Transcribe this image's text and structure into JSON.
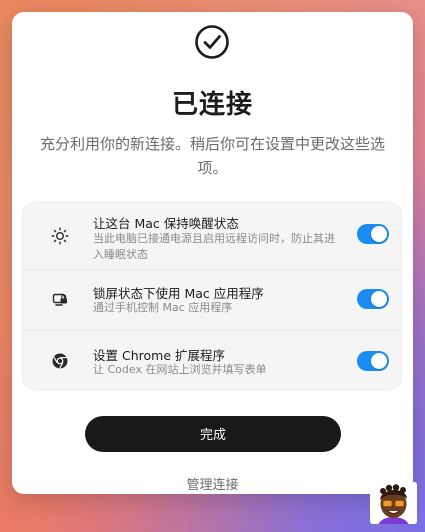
{
  "dialog": {
    "title": "已连接",
    "subtitle": "充分利用你的新连接。稍后你可在设置中更改这些选项。",
    "options": [
      {
        "icon": "sun-icon",
        "title": "让这台 Mac 保持唤醒状态",
        "description": "当此电脑已接通电源且启用远程访问时，防止其进入睡眠状态",
        "enabled": true
      },
      {
        "icon": "mac-lock-icon",
        "title": "锁屏状态下使用 Mac 应用程序",
        "description": "通过手机控制 Mac 应用程序",
        "enabled": true
      },
      {
        "icon": "chrome-icon",
        "title": "设置 Chrome 扩展程序",
        "description": "让 Codex 在网站上浏览并填写表单",
        "enabled": true
      }
    ],
    "done_label": "完成",
    "manage_label": "管理连接"
  },
  "colors": {
    "toggle_on": "#1b8cf2",
    "primary_button": "#18191b"
  }
}
